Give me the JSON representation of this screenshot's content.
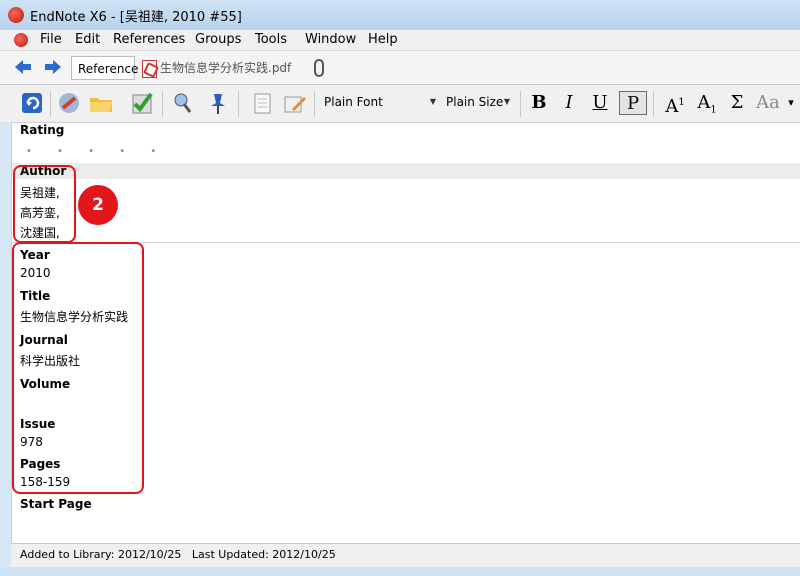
{
  "window": {
    "title": "EndNote X6 - [吴祖建, 2010 #55]"
  },
  "menu": [
    "File",
    "Edit",
    "References",
    "Groups",
    "Tools",
    "Window",
    "Help"
  ],
  "tabs": {
    "reference": "Reference",
    "pdf": "生物信息学分析实践.pdf"
  },
  "toolbar": {
    "font": "Plain Font",
    "size": "Plain Size",
    "bold": "B",
    "italic": "I",
    "underline": "U",
    "plain": "P",
    "superscript": "A",
    "superscript_mark": "1",
    "subscript": "A",
    "subscript_mark": "1",
    "symbol": "Σ",
    "case": "Aa"
  },
  "reference": {
    "rating_label": "Rating",
    "rating_dots": "• • • • •",
    "author_label": "Author",
    "authors": [
      "吴祖建,",
      "高芳銮,",
      "沈建国,"
    ],
    "year_label": "Year",
    "year": "2010",
    "title_label": "Title",
    "title": "生物信息学分析实践",
    "journal_label": "Journal",
    "journal": "科学出版社",
    "volume_label": "Volume",
    "volume": "",
    "issue_label": "Issue",
    "issue": "978",
    "pages_label": "Pages",
    "pages": "158-159",
    "startpage_label": "Start Page"
  },
  "annotation": {
    "badge": "2"
  },
  "status": {
    "added": "Added to Library: 2012/10/25",
    "updated": "Last Updated: 2012/10/25"
  },
  "colors": {
    "highlight": "#e0161c",
    "titlebar": "#cfe3f5"
  }
}
